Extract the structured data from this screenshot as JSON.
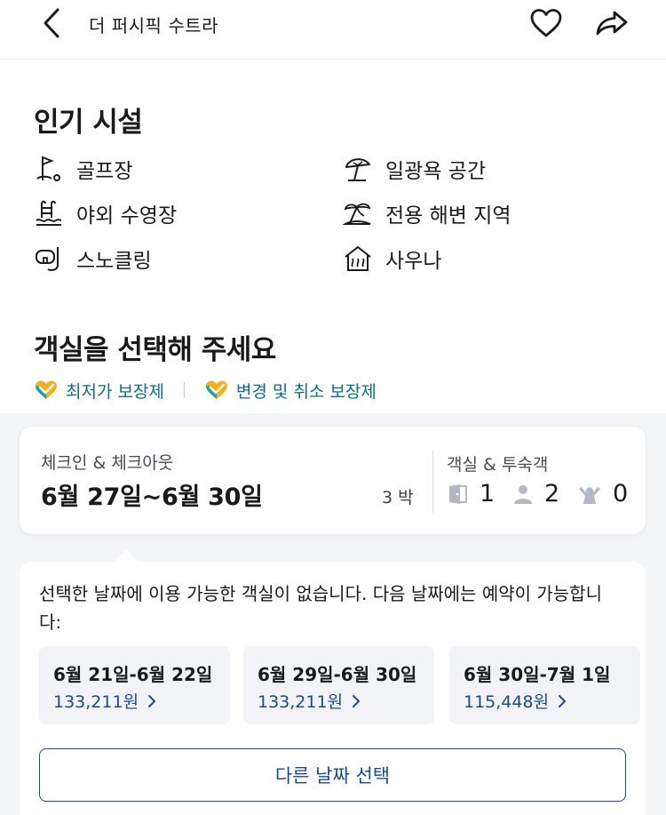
{
  "header": {
    "title": "더 퍼시픽 수트라",
    "back_icon": "chevron-left-icon",
    "favorite_icon": "heart-icon",
    "share_icon": "share-icon"
  },
  "amenities": {
    "title": "인기 시설",
    "items": [
      {
        "label": "골프장",
        "icon": "golf-icon"
      },
      {
        "label": "일광욕 공간",
        "icon": "umbrella-icon"
      },
      {
        "label": "야외 수영장",
        "icon": "pool-icon"
      },
      {
        "label": "전용 해변 지역",
        "icon": "beach-icon"
      },
      {
        "label": "스노클링",
        "icon": "snorkel-icon"
      },
      {
        "label": "사우나",
        "icon": "sauna-icon"
      }
    ]
  },
  "rooms": {
    "title": "객실을 선택해 주세요",
    "guarantees": [
      {
        "label": "최저가 보장제",
        "icon": "heart-check-icon"
      },
      {
        "label": "변경 및 취소 보장제",
        "icon": "heart-check-icon"
      }
    ]
  },
  "booking": {
    "checkin_label": "체크인 & 체크아웃",
    "dates": "6월 27일~6월 30일",
    "nights": "3 박",
    "occupancy_label": "객실 & 투숙객",
    "rooms": "1",
    "adults": "2",
    "children": "0"
  },
  "availability": {
    "message": "선택한 날짜에 이용 가능한 객실이 없습니다. 다음 날짜에는 예약이 가능합니다:",
    "options": [
      {
        "range": "6월 21일-6월 22일",
        "price": "133,211원"
      },
      {
        "range": "6월 29일-6월 30일",
        "price": "133,211원"
      },
      {
        "range": "6월 30일-7월 1일",
        "price": "115,448원"
      }
    ],
    "other_button": "다른 날짜 선택"
  },
  "colors": {
    "accent": "#1d4a8c",
    "guarantee_text": "#0f6c81",
    "heart_teal": "#17a2a4",
    "heart_gold": "#f2b01e"
  }
}
